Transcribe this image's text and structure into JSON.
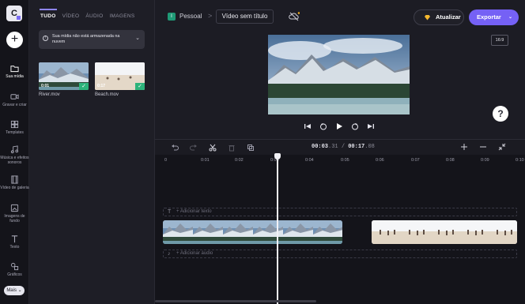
{
  "rail": {
    "items": [
      {
        "label": "Sua mídia",
        "icon": "folder-icon"
      },
      {
        "label": "Gravar e criar",
        "icon": "camera-icon"
      },
      {
        "label": "Templates",
        "icon": "templates-icon"
      },
      {
        "label": "Música e efeitos sonoros",
        "icon": "music-icon"
      },
      {
        "label": "Vídeo de galeria",
        "icon": "film-icon"
      },
      {
        "label": "Imagens de fundo",
        "icon": "image-icon"
      },
      {
        "label": "Texto",
        "icon": "text-icon"
      },
      {
        "label": "Gráficos",
        "icon": "shapes-icon"
      }
    ],
    "more_label": "Mais"
  },
  "media": {
    "tabs": [
      "TUDO",
      "VÍDEO",
      "ÁUDIO",
      "IMAGENS"
    ],
    "notice": "Sua mídia não está armazenada na nuvem",
    "files": [
      {
        "name": "River.mov",
        "duration": "0:01"
      },
      {
        "name": "Beach.mov",
        "duration": "0:17"
      }
    ]
  },
  "header": {
    "project_letter": "I",
    "project_name": "Pessoal",
    "separator": ">",
    "video_title": "Vídeo sem título",
    "update_label": "Atualizar",
    "export_label": "Exportar"
  },
  "preview": {
    "aspect_ratio": "16:9",
    "help": "?"
  },
  "timeline": {
    "current_time": "00:03",
    "current_frac": ".31",
    "total_time": "00:17",
    "total_frac": ".08",
    "time_sep": " / ",
    "ruler": [
      "0",
      "0:01",
      "0:02",
      "0:03",
      "0:04",
      "0:05",
      "0:06",
      "0:07",
      "0:08",
      "0:09",
      "0:10"
    ],
    "add_text": "+ Adicionar texto",
    "add_audio": "+ Adicionar áudio"
  },
  "colors": {
    "accent": "#7561f5",
    "success": "#2db37b",
    "background": "#1c1c24"
  }
}
